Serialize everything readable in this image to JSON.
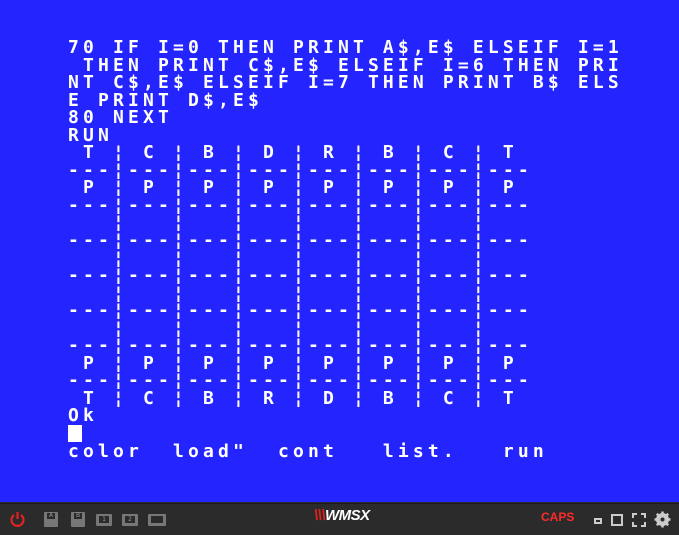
{
  "screen": {
    "lines": [
      "70 IF I=0 THEN PRINT A$,E$ ELSEIF I=1",
      " THEN PRINT C$,E$ ELSEIF I=6 THEN PRI",
      "NT C$,E$ ELSEIF I=7 THEN PRINT B$ ELS",
      "E PRINT D$,E$",
      "80 NEXT",
      "RUN",
      " T ¦ C ¦ B ¦ D ¦ R ¦ B ¦ C ¦ T",
      "---¦---¦---¦---¦---¦---¦---¦---",
      " P ¦ P ¦ P ¦ P ¦ P ¦ P ¦ P ¦ P",
      "---¦---¦---¦---¦---¦---¦---¦---",
      "   ¦   ¦   ¦   ¦   ¦   ¦   ¦",
      "---¦---¦---¦---¦---¦---¦---¦---",
      "   ¦   ¦   ¦   ¦   ¦   ¦   ¦",
      "---¦---¦---¦---¦---¦---¦---¦---",
      "   ¦   ¦   ¦   ¦   ¦   ¦   ¦",
      "---¦---¦---¦---¦---¦---¦---¦---",
      "   ¦   ¦   ¦   ¦   ¦   ¦   ¦",
      "---¦---¦---¦---¦---¦---¦---¦---",
      " P ¦ P ¦ P ¦ P ¦ P ¦ P ¦ P ¦ P",
      "---¦---¦---¦---¦---¦---¦---¦---",
      " T ¦ C ¦ B ¦ R ¦ D ¦ B ¦ C ¦ T",
      "Ok"
    ],
    "function_keys": "color  load\"  cont   list.   run",
    "background_color": "#2424fe"
  },
  "toolbar": {
    "disk_a": "A",
    "disk_b": "B",
    "cart_1": "1",
    "cart_2": "2",
    "logo": "WMSX",
    "caps": "CAPS"
  }
}
